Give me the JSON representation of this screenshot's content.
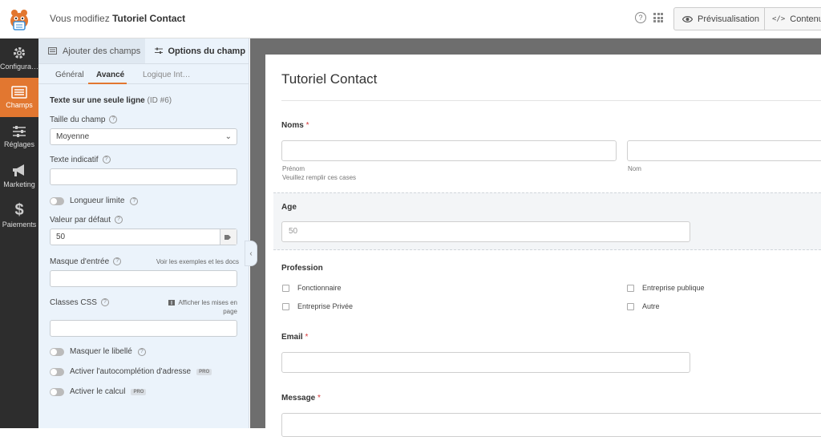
{
  "header": {
    "title_prefix": "Vous modifiez",
    "form_name": "Tutoriel Contact",
    "help_icon": "?",
    "preview_label": "Prévisualisation",
    "content_label": "Contenu"
  },
  "nav": {
    "items": [
      {
        "label": "Configura…",
        "icon": "gear-icon"
      },
      {
        "label": "Champs",
        "icon": "fields-icon"
      },
      {
        "label": "Réglages",
        "icon": "sliders-icon"
      },
      {
        "label": "Marketing",
        "icon": "megaphone-icon"
      },
      {
        "label": "Paiements",
        "icon": "dollar-icon"
      }
    ],
    "active_index": 1
  },
  "panel": {
    "tabs": {
      "add_fields": "Ajouter des champs",
      "field_options": "Options du champ"
    },
    "subtabs": {
      "general": "Général",
      "advanced": "Avancé",
      "logic": "Logique Int…"
    },
    "field_type": "Texte sur une seule ligne",
    "field_id": "(ID #6)",
    "size_label": "Taille du champ",
    "size_value": "Moyenne",
    "placeholder_label": "Texte indicatif",
    "limit_label": "Longueur limite",
    "default_label": "Valeur par défaut",
    "default_value": "50",
    "mask_label": "Masque d'entrée",
    "mask_link": "Voir les exemples et les docs",
    "css_label": "Classes CSS",
    "css_link": "Afficher les mises en page",
    "hide_label": "Masquer le libellé",
    "autocomplete_label": "Activer l'autocomplétion d'adresse",
    "calc_label": "Activer le calcul",
    "pro_badge": "PRO",
    "collapse": "‹"
  },
  "form": {
    "title": "Tutoriel Contact",
    "names_label": "Noms",
    "required_mark": "*",
    "first_sub": "Prénom",
    "last_sub": "Nom",
    "names_help": "Veuillez remplir ces cases",
    "age_label": "Age",
    "age_placeholder": "50",
    "profession_label": "Profession",
    "profession_options": [
      "Fonctionnaire",
      "Entreprise Privée",
      "Entreprise publique",
      "Autre"
    ],
    "email_label": "Email",
    "message_label": "Message"
  },
  "colors": {
    "accent": "#e27730",
    "nav_bg": "#2d2d2d",
    "panel_bg": "#ebf3fb",
    "required": "#d63638"
  }
}
